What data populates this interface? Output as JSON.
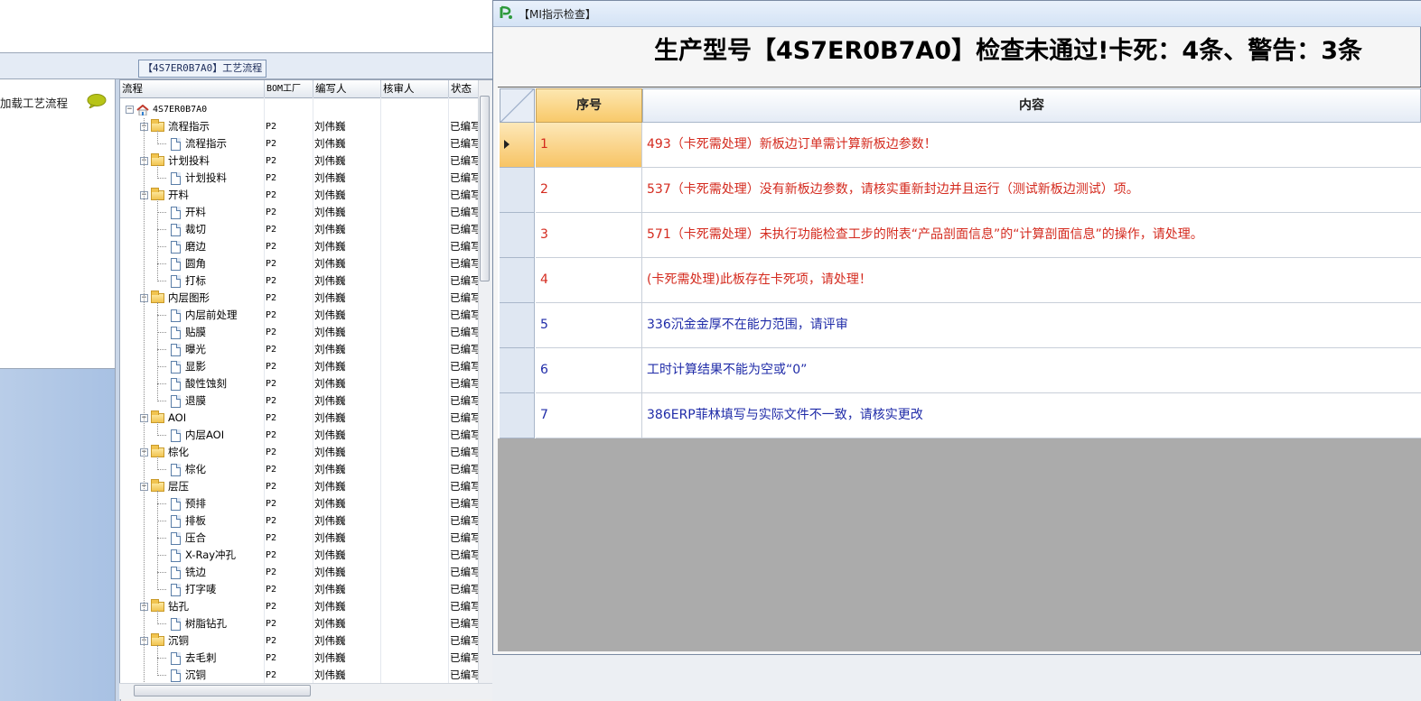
{
  "left_tab_caption": "【4S7ER0B7A0】工艺流程",
  "nav": {
    "load_label": "加载工艺流程"
  },
  "grid": {
    "headers": {
      "process": "流程",
      "bom": "BOM工厂",
      "writer": "编写人",
      "reviewer": "核审人",
      "status": "状态"
    },
    "root": "4S7ER0B7A0",
    "rows": [
      {
        "name": "流程指示",
        "level": 1,
        "folder": true,
        "bom": "P2",
        "writer": "刘伟巍",
        "status": "已编写"
      },
      {
        "name": "流程指示",
        "level": 2,
        "folder": false,
        "bom": "P2",
        "writer": "刘伟巍",
        "status": "已编写"
      },
      {
        "name": "计划投料",
        "level": 1,
        "folder": true,
        "bom": "P2",
        "writer": "刘伟巍",
        "status": "已编写"
      },
      {
        "name": "计划投料",
        "level": 2,
        "folder": false,
        "bom": "P2",
        "writer": "刘伟巍",
        "status": "已编写"
      },
      {
        "name": "开料",
        "level": 1,
        "folder": true,
        "bom": "P2",
        "writer": "刘伟巍",
        "status": "已编写"
      },
      {
        "name": "开料",
        "level": 2,
        "folder": false,
        "bom": "P2",
        "writer": "刘伟巍",
        "status": "已编写"
      },
      {
        "name": "裁切",
        "level": 2,
        "folder": false,
        "bom": "P2",
        "writer": "刘伟巍",
        "status": "已编写"
      },
      {
        "name": "磨边",
        "level": 2,
        "folder": false,
        "bom": "P2",
        "writer": "刘伟巍",
        "status": "已编写"
      },
      {
        "name": "圆角",
        "level": 2,
        "folder": false,
        "bom": "P2",
        "writer": "刘伟巍",
        "status": "已编写"
      },
      {
        "name": "打标",
        "level": 2,
        "folder": false,
        "bom": "P2",
        "writer": "刘伟巍",
        "status": "已编写"
      },
      {
        "name": "内层图形",
        "level": 1,
        "folder": true,
        "bom": "P2",
        "writer": "刘伟巍",
        "status": "已编写"
      },
      {
        "name": "内层前处理",
        "level": 2,
        "folder": false,
        "bom": "P2",
        "writer": "刘伟巍",
        "status": "已编写"
      },
      {
        "name": "贴膜",
        "level": 2,
        "folder": false,
        "bom": "P2",
        "writer": "刘伟巍",
        "status": "已编写"
      },
      {
        "name": "曝光",
        "level": 2,
        "folder": false,
        "bom": "P2",
        "writer": "刘伟巍",
        "status": "已编写"
      },
      {
        "name": "显影",
        "level": 2,
        "folder": false,
        "bom": "P2",
        "writer": "刘伟巍",
        "status": "已编写"
      },
      {
        "name": "酸性蚀刻",
        "level": 2,
        "folder": false,
        "bom": "P2",
        "writer": "刘伟巍",
        "status": "已编写"
      },
      {
        "name": "退膜",
        "level": 2,
        "folder": false,
        "bom": "P2",
        "writer": "刘伟巍",
        "status": "已编写"
      },
      {
        "name": "AOI",
        "level": 1,
        "folder": true,
        "bom": "P2",
        "writer": "刘伟巍",
        "status": "已编写"
      },
      {
        "name": "内层AOI",
        "level": 2,
        "folder": false,
        "bom": "P2",
        "writer": "刘伟巍",
        "status": "已编写"
      },
      {
        "name": "棕化",
        "level": 1,
        "folder": true,
        "bom": "P2",
        "writer": "刘伟巍",
        "status": "已编写"
      },
      {
        "name": "棕化",
        "level": 2,
        "folder": false,
        "bom": "P2",
        "writer": "刘伟巍",
        "status": "已编写"
      },
      {
        "name": "层压",
        "level": 1,
        "folder": true,
        "bom": "P2",
        "writer": "刘伟巍",
        "status": "已编写"
      },
      {
        "name": "预排",
        "level": 2,
        "folder": false,
        "bom": "P2",
        "writer": "刘伟巍",
        "status": "已编写"
      },
      {
        "name": "排板",
        "level": 2,
        "folder": false,
        "bom": "P2",
        "writer": "刘伟巍",
        "status": "已编写"
      },
      {
        "name": "压合",
        "level": 2,
        "folder": false,
        "bom": "P2",
        "writer": "刘伟巍",
        "status": "已编写"
      },
      {
        "name": "X-Ray冲孔",
        "level": 2,
        "folder": false,
        "bom": "P2",
        "writer": "刘伟巍",
        "status": "已编写"
      },
      {
        "name": "铣边",
        "level": 2,
        "folder": false,
        "bom": "P2",
        "writer": "刘伟巍",
        "status": "已编写"
      },
      {
        "name": "打字唛",
        "level": 2,
        "folder": false,
        "bom": "P2",
        "writer": "刘伟巍",
        "status": "已编写"
      },
      {
        "name": "钻孔",
        "level": 1,
        "folder": true,
        "bom": "P2",
        "writer": "刘伟巍",
        "status": "已编写"
      },
      {
        "name": "树脂钻孔",
        "level": 2,
        "folder": false,
        "bom": "P2",
        "writer": "刘伟巍",
        "status": "已编写"
      },
      {
        "name": "沉铜",
        "level": 1,
        "folder": true,
        "bom": "P2",
        "writer": "刘伟巍",
        "status": "已编写"
      },
      {
        "name": "去毛刺",
        "level": 2,
        "folder": false,
        "bom": "P2",
        "writer": "刘伟巍",
        "status": "已编写"
      },
      {
        "name": "沉铜",
        "level": 2,
        "folder": false,
        "bom": "P2",
        "writer": "刘伟巍",
        "status": "已编写"
      }
    ]
  },
  "dialog": {
    "title": "【MI指示检查】",
    "heading": "生产型号【4S7ER0B7A0】检查未通过!卡死：4条、警告：3条",
    "columns": {
      "no": "序号",
      "content": "内容"
    },
    "rows": [
      {
        "no": "1",
        "text": "493（卡死需处理）新板边订单需计算新板边参数！",
        "color": "#d42a1e"
      },
      {
        "no": "2",
        "text": "537（卡死需处理）没有新板边参数，请核实重新封边并且运行（测试新板边测试）项。",
        "color": "#d42a1e"
      },
      {
        "no": "3",
        "text": "571（卡死需处理）未执行功能检查工步的附表“产品剖面信息”的“计算剖面信息”的操作，请处理。",
        "color": "#d42a1e"
      },
      {
        "no": "4",
        "text": "(卡死需处理)此板存在卡死项，请处理！",
        "color": "#d42a1e"
      },
      {
        "no": "5",
        "text": "336沉金金厚不在能力范围，请评审",
        "color": "#1f2ba8"
      },
      {
        "no": "6",
        "text": "工时计算结果不能为空或“0”",
        "color": "#1f2ba8"
      },
      {
        "no": "7",
        "text": "386ERP菲林填写与实际文件不一致，请核实更改",
        "color": "#1f2ba8"
      }
    ],
    "selected_row": 1
  },
  "icons": [
    "chat-bubble-icon",
    "home-icon",
    "folder-icon",
    "document-icon",
    "app-logo-icon",
    "row-pointer-icon"
  ]
}
